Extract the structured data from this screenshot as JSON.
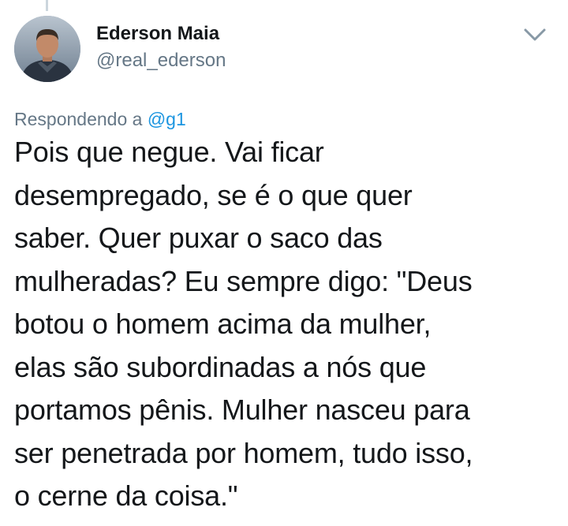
{
  "author": {
    "display_name": "Ederson Maia",
    "handle": "@real_ederson"
  },
  "reply": {
    "prefix": "Respondendo a ",
    "mention": "@g1"
  },
  "tweet": {
    "lines": [
      "Pois que negue. Vai ficar",
      "desempregado, se é o que quer",
      "saber. Quer puxar o saco das",
      "mulheradas? Eu sempre digo: \"Deus",
      "botou o homem acima da mulher,",
      "elas são subordinadas a nós que",
      "portamos pênis. Mulher nasceu para",
      "ser penetrada por homem, tudo isso,",
      "o cerne da coisa.\""
    ]
  },
  "icons": {
    "menu": "chevron-down-icon",
    "avatar": "avatar"
  },
  "colors": {
    "text": "#14171a",
    "secondary": "#657786",
    "link": "#1b95e0"
  }
}
